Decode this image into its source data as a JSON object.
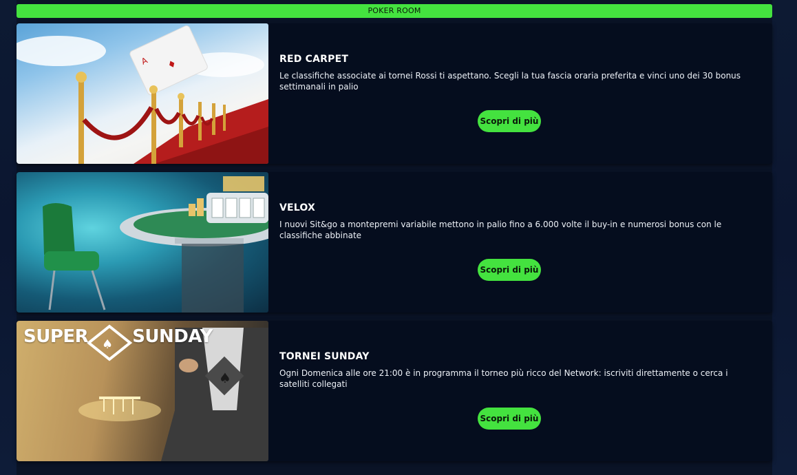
{
  "section": {
    "title": "POKER ROOM"
  },
  "cards": [
    {
      "title": "RED CARPET",
      "description": "Le classifiche associate ai tornei Rossi ti aspettano. Scegli la tua fascia oraria preferita e vinci uno dei 30 bonus settimanali in palio",
      "cta": "Scopri di più"
    },
    {
      "title": "VELOX",
      "description": "I nuovi Sit&go a montepremi variabile mettono in palio fino a 6.000 volte il buy-in e numerosi bonus con le classifiche abbinate",
      "cta": "Scopri di più"
    },
    {
      "title": "TORNEI SUNDAY",
      "description": "Ogni Domenica alle ore 21:00 è in programma il torneo più ricco del Network: iscriviti direttamente o cerca i satelliti collegati",
      "cta": "Scopri di più",
      "image_logo": {
        "left": "SUPER",
        "right": "SUNDAY"
      }
    }
  ],
  "colors": {
    "accent": "#44e23f",
    "background": "#0a1326",
    "card": "#050d1e"
  }
}
